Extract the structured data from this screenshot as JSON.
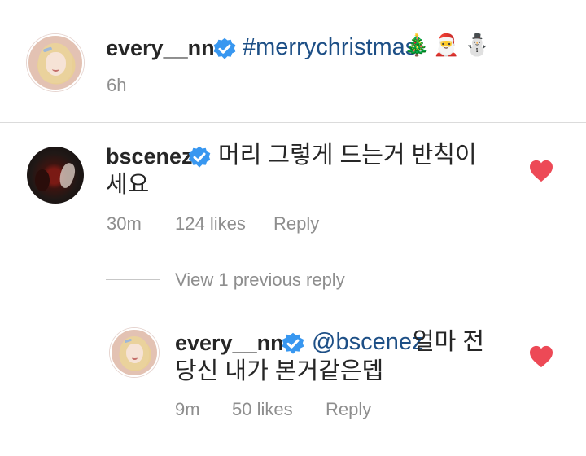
{
  "caption": {
    "username": "every__nn",
    "hashtag": "#merrychristmas",
    "emojis": [
      "🎄",
      "🎅",
      "⛄"
    ],
    "time": "6h"
  },
  "comments": [
    {
      "username": "bscenez",
      "text_line1": "머리 그렇게 드는거 반칙이",
      "text_line2": "세요",
      "time": "30m",
      "likes": "124 likes",
      "reply": "Reply",
      "liked": true
    }
  ],
  "view_replies": "View 1 previous reply",
  "reply": {
    "username": "every__nn",
    "mention": "@bscenez",
    "text_line1_rest": "얼마 전",
    "text_line2": "당신 내가 본거같은뎁",
    "time": "9m",
    "likes": "50 likes",
    "reply": "Reply",
    "liked": true
  },
  "colors": {
    "verified": "#3897f0",
    "heart": "#ed4956",
    "hashtag": "#1d4f86",
    "meta": "#8e8e8e"
  },
  "icons": {
    "verified": "verified-badge-icon",
    "heart": "heart-icon"
  }
}
